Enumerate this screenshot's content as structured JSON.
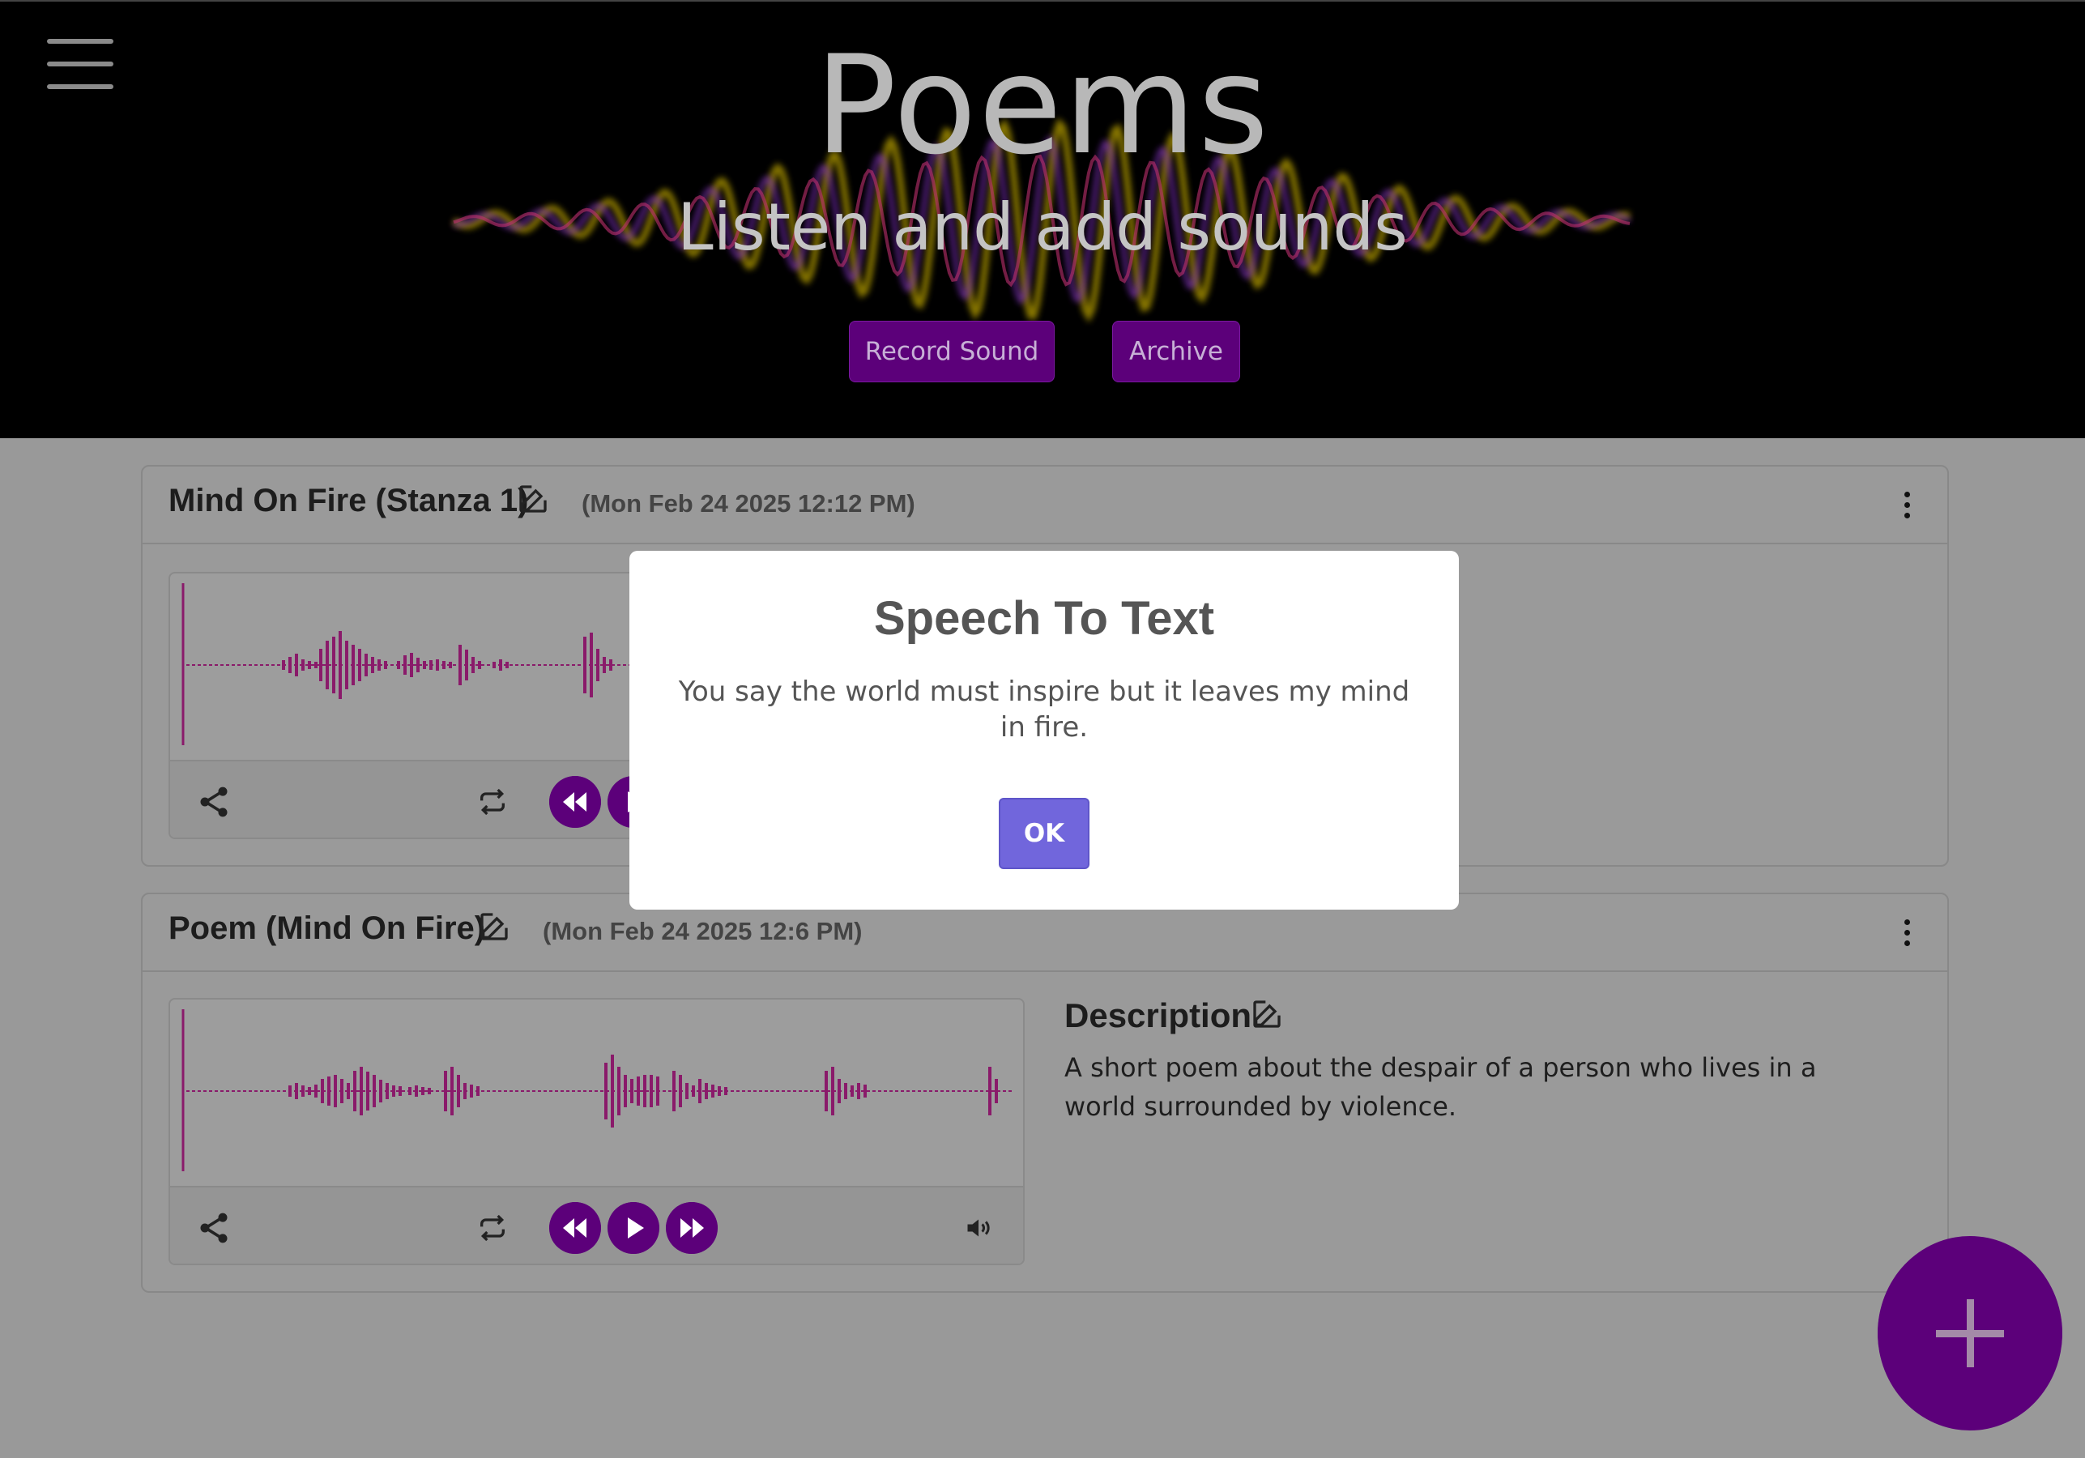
{
  "header": {
    "title": "Poems",
    "subtitle": "Listen and add sounds",
    "buttons": {
      "record": "Record Sound",
      "archive": "Archive"
    }
  },
  "cards": [
    {
      "title": "Mind On Fire (Stanza 1)",
      "date": "(Mon Feb 24 2025 12:12 PM)"
    },
    {
      "title": "Poem (Mind On Fire)",
      "date": "(Mon Feb 24 2025 12:6 PM)",
      "description": {
        "title": "Description",
        "text": "A short poem about the despair of a person who lives in a world surrounded by violence."
      }
    }
  ],
  "modal": {
    "title": "Speech To Text",
    "text": "You say the world must inspire but it leaves my mind in fire.",
    "ok": "OK"
  },
  "colors": {
    "accent": "#5c007a",
    "wave": "#8a1a6a",
    "ok": "#7166dc"
  },
  "icons": [
    "menu-icon",
    "edit-icon",
    "more-vertical-icon",
    "share-icon",
    "repeat-icon",
    "rewind-icon",
    "play-icon",
    "fast-forward-icon",
    "volume-icon",
    "plus-icon"
  ]
}
